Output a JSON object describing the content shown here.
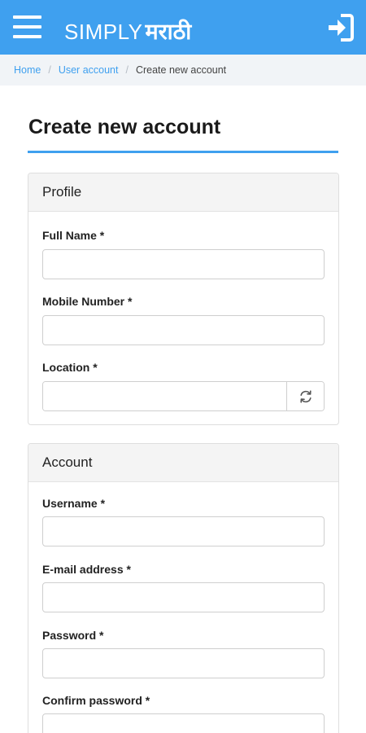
{
  "header": {
    "brand_latin": "SIMPLY",
    "brand_devanagari": "मराठी",
    "bar_color": "#3fa0ef",
    "menu_icon": "hamburger-menu-icon",
    "login_icon": "sign-in-icon"
  },
  "breadcrumb": {
    "items": [
      {
        "label": "Home",
        "link": true
      },
      {
        "label": "User account",
        "link": true
      },
      {
        "label": "Create new account",
        "link": false
      }
    ],
    "separator": "/"
  },
  "page": {
    "title": "Create new account"
  },
  "profile": {
    "heading": "Profile",
    "full_name_label": "Full Name *",
    "full_name_value": "",
    "mobile_label": "Mobile Number *",
    "mobile_value": "",
    "location_label": "Location *",
    "location_value": "",
    "location_button_icon": "refresh-icon"
  },
  "account": {
    "heading": "Account",
    "username_label": "Username *",
    "username_value": "",
    "email_label": "E-mail address *",
    "email_value": "",
    "password_label": "Password *",
    "password_value": "",
    "confirm_password_label": "Confirm password *",
    "confirm_password_value": ""
  }
}
